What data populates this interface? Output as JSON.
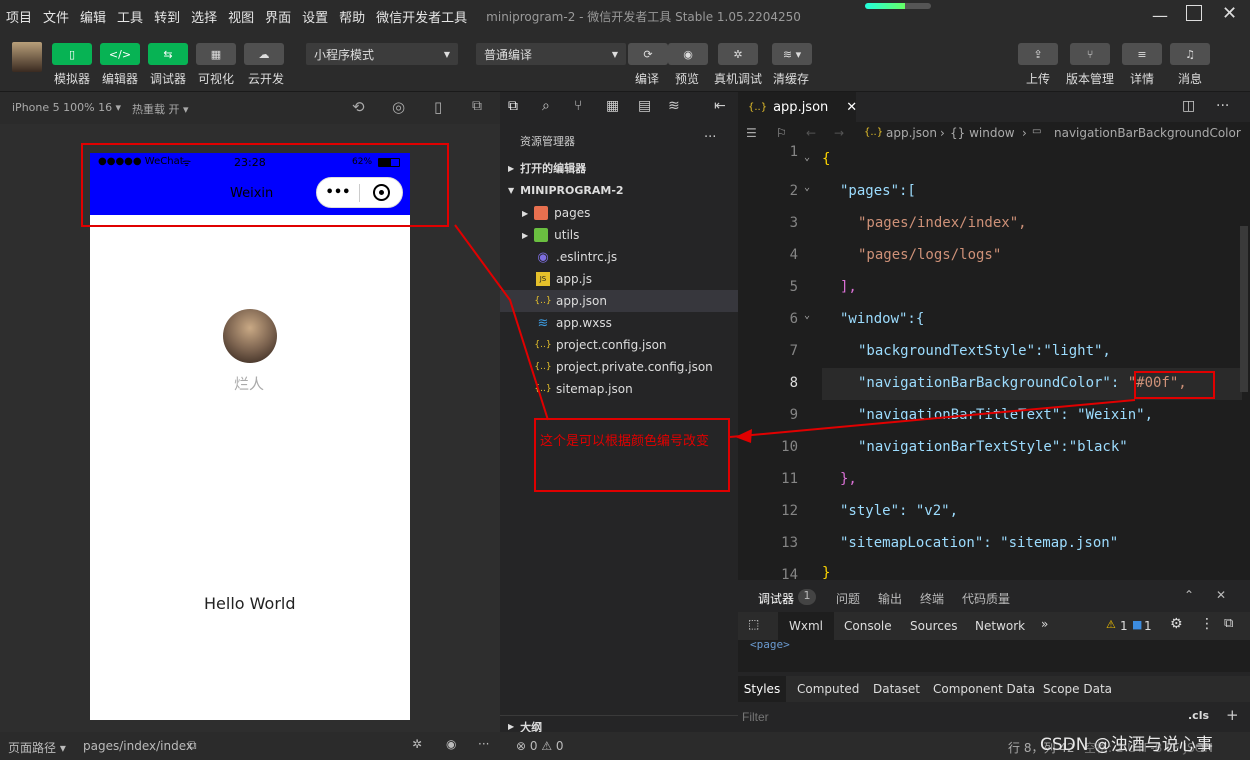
{
  "menu": {
    "items": [
      "项目",
      "文件",
      "编辑",
      "工具",
      "转到",
      "选择",
      "视图",
      "界面",
      "设置",
      "帮助",
      "微信开发者工具"
    ],
    "title": "miniprogram-2 - 微信开发者工具 Stable 1.05.2204250"
  },
  "toolbar": {
    "left_labels": [
      "模拟器",
      "编辑器",
      "调试器",
      "可视化",
      "云开发"
    ],
    "mode_select": "小程序模式",
    "compile_select": "普通编译",
    "mid_labels": [
      "编译",
      "预览",
      "真机调试",
      "清缓存"
    ],
    "right_labels": [
      "上传",
      "版本管理",
      "详情",
      "消息"
    ]
  },
  "simulator": {
    "device": "iPhone 5 100% 16 ▾",
    "hotreload": "热重载 开 ▾",
    "status_left": "●●●●● WeChat",
    "status_time": "23:28",
    "status_right": "62%",
    "nav_title": "Weixin",
    "capsule_more": "•••",
    "nickname": "烂人",
    "hello": "Hello World",
    "nav_color": "#0000ff"
  },
  "sim_footer": {
    "path_label": "页面路径 ▾",
    "path": "pages/index/index"
  },
  "explorer": {
    "title": "资源管理器",
    "more": "···",
    "open_editors": "打开的编辑器",
    "project": "MINIPROGRAM-2",
    "files": [
      {
        "name": "pages",
        "icon": "folder-icon"
      },
      {
        "name": "utils",
        "icon": "folder-icon"
      },
      {
        "name": ".eslintrc.js",
        "icon": "eslint-icon"
      },
      {
        "name": "app.js",
        "icon": "js-file-icon"
      },
      {
        "name": "app.json",
        "icon": "json-file-icon"
      },
      {
        "name": "app.wxss",
        "icon": "css-file-icon"
      },
      {
        "name": "project.config.json",
        "icon": "json-file-icon"
      },
      {
        "name": "project.private.config.json",
        "icon": "json-file-icon"
      },
      {
        "name": "sitemap.json",
        "icon": "json-file-icon"
      }
    ],
    "outline": "大纲",
    "footer": "⊗ 0 ⚠ 0"
  },
  "editor": {
    "tab": "app.json",
    "breadcrumb": [
      "app.json",
      "{} window",
      "navigationBarBackgroundColor"
    ],
    "lines": [
      {
        "n": "1",
        "t": "{"
      },
      {
        "n": "2",
        "t": "\"pages\":["
      },
      {
        "n": "3",
        "t": "\"pages/index/index\","
      },
      {
        "n": "4",
        "t": "\"pages/logs/logs\""
      },
      {
        "n": "5",
        "t": "],"
      },
      {
        "n": "6",
        "t": "\"window\":{"
      },
      {
        "n": "7",
        "t": "\"backgroundTextStyle\":\"light\","
      },
      {
        "n": "8",
        "t": "\"navigationBarBackgroundColor\": \"#00f\","
      },
      {
        "n": "9",
        "t": "\"navigationBarTitleText\": \"Weixin\","
      },
      {
        "n": "10",
        "t": "\"navigationBarTextStyle\":\"black\""
      },
      {
        "n": "11",
        "t": "},"
      },
      {
        "n": "12",
        "t": "\"style\": \"v2\","
      },
      {
        "n": "13",
        "t": "\"sitemapLocation\": \"sitemap.json\""
      },
      {
        "n": "14",
        "t": "}"
      }
    ]
  },
  "devtools": {
    "tabs": [
      "调试器",
      "问题",
      "输出",
      "终端",
      "代码质量"
    ],
    "debugger_badge": "1",
    "panels": [
      "Wxml",
      "Console",
      "Sources",
      "Network",
      "»"
    ],
    "warn_count": "1",
    "info_count": "1",
    "page_tag": "<page>",
    "subtabs": [
      "Styles",
      "Computed",
      "Dataset",
      "Component Data",
      "Scope Data"
    ],
    "filter_placeholder": "Filter",
    "cls": ".cls",
    "plus": "+"
  },
  "status_right": {
    "position": "行 8，列 42",
    "encoding": "空格: 2  UTF-8  LF  JSON",
    "watermark": "CSDN @浊酒与说心事"
  },
  "annotation": {
    "text": "这个是可以根据颜色编号改变",
    "color": "#e00000"
  }
}
